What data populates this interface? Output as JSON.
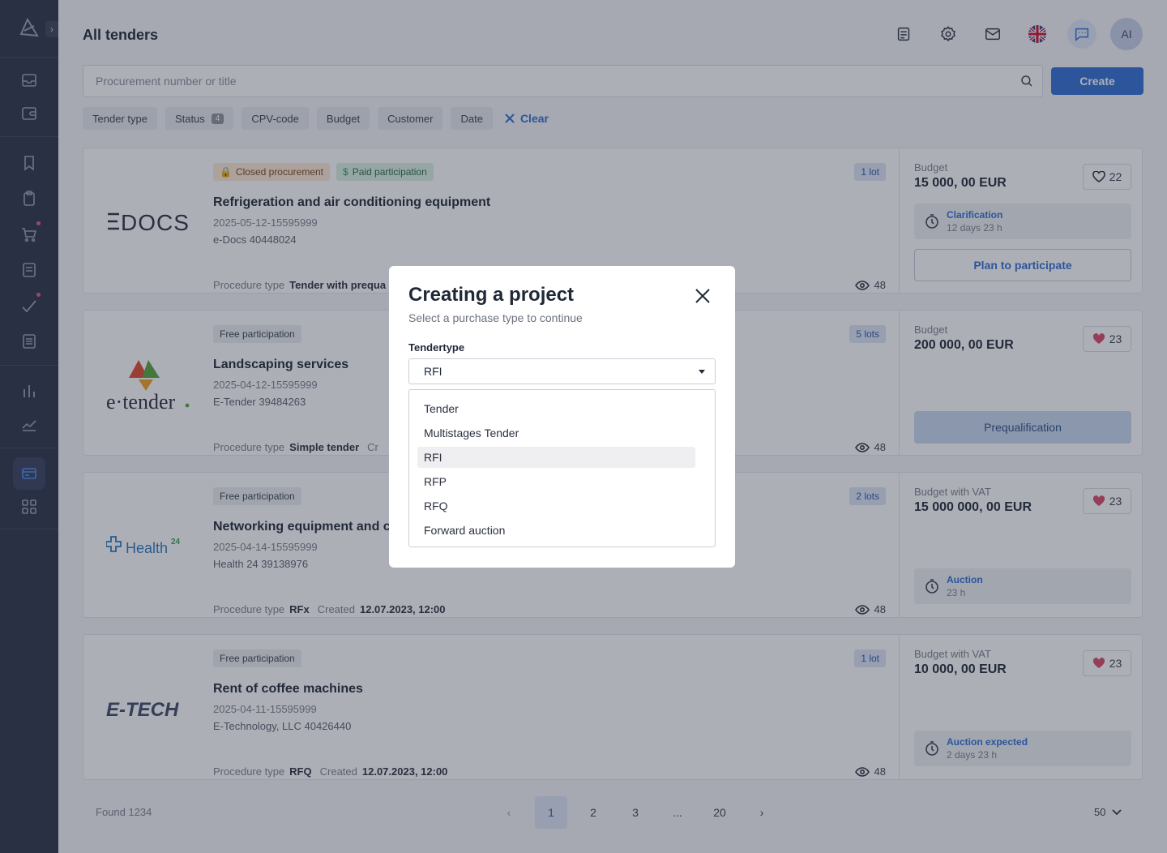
{
  "header": {
    "title": "All tenders",
    "avatar_initials": "AI"
  },
  "search": {
    "placeholder": "Procurement number or title",
    "create_label": "Create"
  },
  "filters": {
    "items": [
      "Tender type",
      "Status",
      "CPV-code",
      "Budget",
      "Customer",
      "Date"
    ],
    "status_count": "4",
    "clear_label": "Clear"
  },
  "cards": [
    {
      "logo_text": "EDOCS",
      "badges": [
        "Closed procurement",
        "Paid participation"
      ],
      "lots": "1 lot",
      "title": "Refrigeration and air conditioning equipment",
      "number": "2025-05-12-15595999",
      "org": "e-Docs 40448024",
      "procedure_label": "Procedure type",
      "procedure_value": "Tender with prequa",
      "created_label": "",
      "created_value": "",
      "views": "48",
      "budget_label": "Budget",
      "budget_value": "15 000, 00 EUR",
      "favorites": "22",
      "timer_label": "Clarification",
      "timer_sub": "12 days 23 h",
      "action_label": "Plan to participate"
    },
    {
      "logo_text": "e·tender·",
      "badges": [
        "Free participation"
      ],
      "lots": "5 lots",
      "title": "Landscaping services",
      "number": "2025-04-12-15595999",
      "org": "E-Tender 39484263",
      "procedure_label": "Procedure type",
      "procedure_value": "Simple tender",
      "created_label": "Cr",
      "created_value": "",
      "views": "48",
      "budget_label": "Budget",
      "budget_value": "200 000, 00 EUR",
      "favorites": "23",
      "action_label": "Prequalification"
    },
    {
      "logo_text": "Health",
      "logo_sup": "24",
      "badges": [
        "Free participation"
      ],
      "lots": "2 lots",
      "title": "Networking equipment and c",
      "number": "2025-04-14-15595999",
      "org": "Health 24 39138976",
      "procedure_label": "Procedure type",
      "procedure_value": "RFx",
      "created_label": "Created",
      "created_value": "12.07.2023, 12:00",
      "views": "48",
      "budget_label": "Budget",
      "budget_vat": "with VAT",
      "budget_value": "15 000 000, 00 EUR",
      "favorites": "23",
      "timer_label": "Auction",
      "timer_sub": "23 h"
    },
    {
      "logo_text": "E-TECH",
      "badges": [
        "Free participation"
      ],
      "lots": "1 lot",
      "title": "Rent of coffee machines",
      "number": "2025-04-11-15595999",
      "org": "E-Technology, LLC 40426440",
      "procedure_label": "Procedure type",
      "procedure_value": "RFQ",
      "created_label": "Created",
      "created_value": "12.07.2023, 12:00",
      "views": "48",
      "budget_label": "Budget",
      "budget_vat": "with VAT",
      "budget_value": "10 000, 00 EUR",
      "favorites": "23",
      "timer_label": "Auction expected",
      "timer_sub": "2 days 23 h"
    }
  ],
  "footer": {
    "found": "Found 1234",
    "pages": [
      "1",
      "2",
      "3",
      "...",
      "20"
    ],
    "per_page": "50"
  },
  "modal": {
    "title": "Creating a project",
    "subtitle": "Select a purchase type to continue",
    "field_label": "Tendertype",
    "selected": "RFI",
    "options": [
      "Tender",
      "Multistages Tender",
      "RFI",
      "RFP",
      "RFQ",
      "Forward auction"
    ]
  },
  "colors": {
    "accent": "#2f6fd6",
    "sidebar": "#2d3347",
    "favorite_filled": "#d94a6a"
  }
}
